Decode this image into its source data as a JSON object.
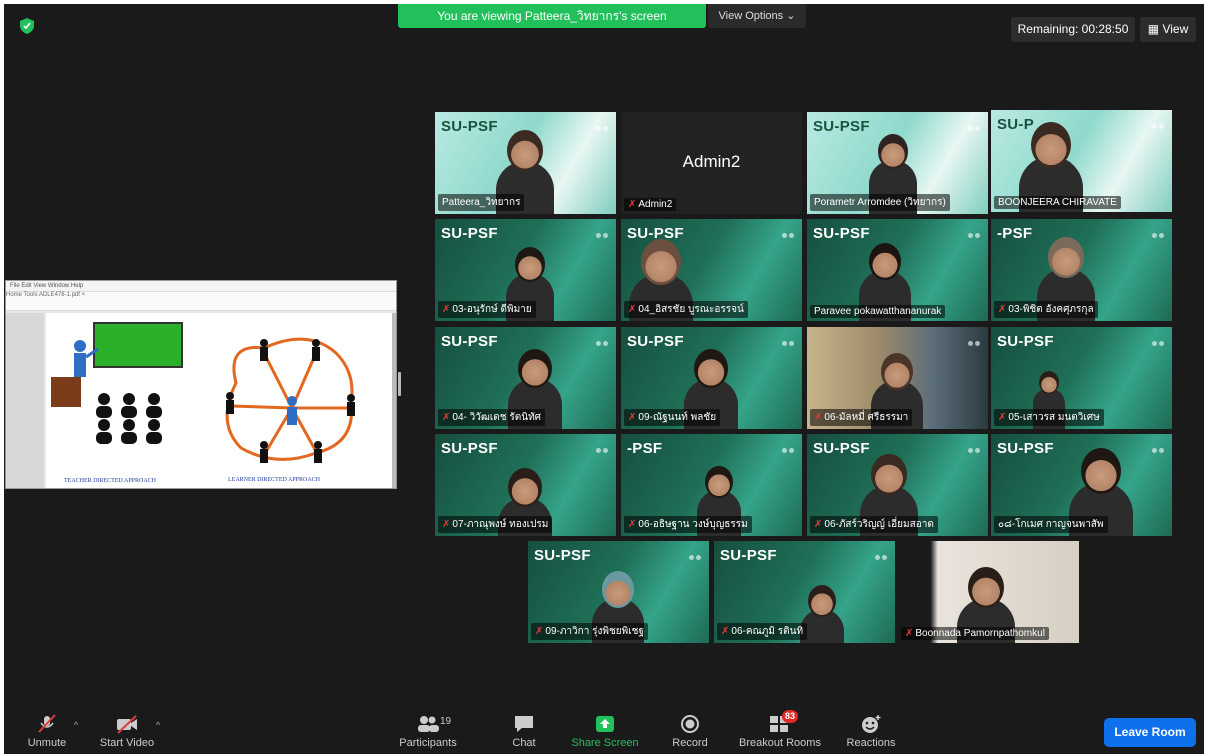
{
  "banner": {
    "viewing": "You are viewing Patteera_วิทยากร's screen",
    "view_options": "View Options ⌄"
  },
  "top_right": {
    "remaining": "Remaining: 00:28:50",
    "view": "View"
  },
  "shared_screen": {
    "menu": "File  Edit  View  Window  Help",
    "toolbar": "Home   Tools   ADLE478-1.pdf ×",
    "caption_left": "TEACHER DIRECTED APPROACH",
    "caption_right": "LEARNER DIRECTED APPROACH"
  },
  "tiles": [
    {
      "name": "Patteera_วิทยากร",
      "psf": "SU-PSF",
      "muted": false
    },
    {
      "name": "Admin2",
      "big": "Admin2",
      "muted": true
    },
    {
      "name": "Porametr Arromdee (วิทยากร)",
      "psf": "SU-PSF",
      "muted": false
    },
    {
      "name": "BOONJEERA CHIRAVATE",
      "psf": "SU-P",
      "muted": false
    },
    {
      "name": "03-อนุรักษ์ ดีพิมาย",
      "psf": "SU-PSF",
      "muted": true
    },
    {
      "name": "04_อิสรชัย บูรณะอรรจน์",
      "psf": "SU-PSF",
      "muted": true
    },
    {
      "name": "Paravee pokawatthananurak",
      "psf": "SU-PSF",
      "muted": false
    },
    {
      "name": "03-พิชิต อังคศุภรกุล",
      "psf": "-PSF",
      "muted": true
    },
    {
      "name": "04- วิวัฒเดช รัตนิทัศ",
      "psf": "SU-PSF",
      "muted": true
    },
    {
      "name": "09-ณัฐนนท์ พลชัย",
      "psf": "SU-PSF",
      "muted": true
    },
    {
      "name": "06-มัลหมี่ ศรีธรรมา",
      "psf": "",
      "muted": true
    },
    {
      "name": "05-เสาวรส มนตวิเศษ",
      "psf": "SU-PSF",
      "muted": true
    },
    {
      "name": "07-ภาณุพงษ์ ทองเปรม",
      "psf": "SU-PSF",
      "muted": true
    },
    {
      "name": "06-อธิษฐาน วงษ์บุญธรรม",
      "psf": "-PSF",
      "muted": true
    },
    {
      "name": "06-ภัสร์วริญญ์ เอี่ยมสอาด",
      "psf": "SU-PSF",
      "muted": true
    },
    {
      "name": "๐๘-โกเมศ กาญจนพาสัพ",
      "psf": "SU-PSF",
      "muted": false
    },
    {
      "name": "09-ภาวิกา รุ่งพิชยพิเชฐ",
      "psf": "SU-PSF",
      "muted": true
    },
    {
      "name": "06-คณภูมิ รตินทิ",
      "psf": "SU-PSF",
      "muted": true
    },
    {
      "name": "Boonnada Pamornpathomkul",
      "psf": "",
      "muted": true
    }
  ],
  "toolbar": {
    "unmute": "Unmute",
    "start_video": "Start Video",
    "participants": "Participants",
    "participants_count": "19",
    "chat": "Chat",
    "share_screen": "Share Screen",
    "record": "Record",
    "breakout": "Breakout Rooms",
    "breakout_badge": "83",
    "reactions": "Reactions",
    "leave": "Leave Room"
  },
  "colors": {
    "banner": "#22c05a",
    "leave": "#0e71eb",
    "share": "#22c05a",
    "active_outline": "#b6e06a"
  }
}
